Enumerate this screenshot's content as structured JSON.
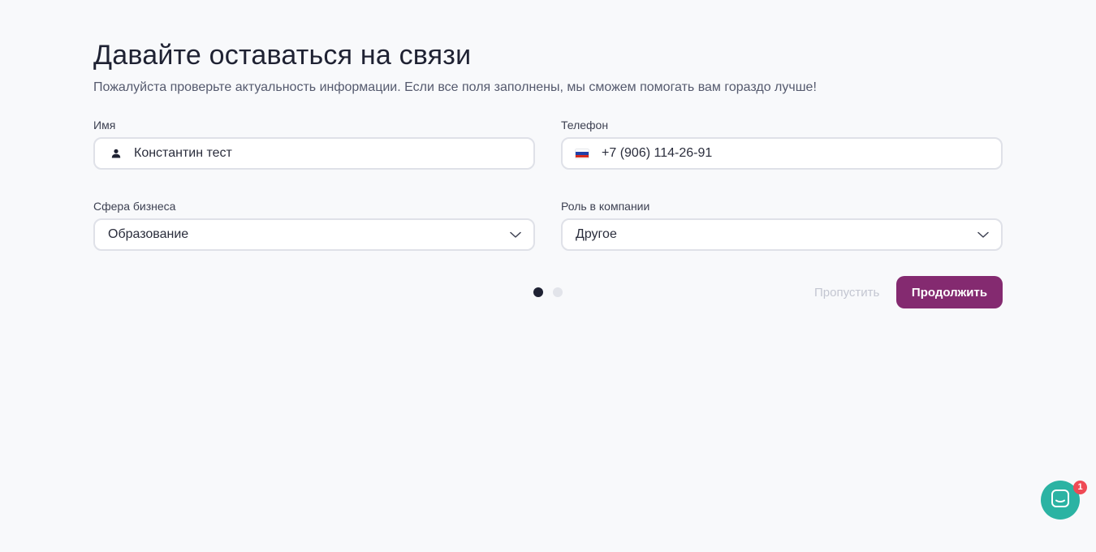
{
  "header": {
    "title": "Давайте оставаться на связи",
    "subtitle": "Пожалуйста проверьте актуальность информации. Если все поля заполнены, мы сможем помогать вам гораздо лучше!"
  },
  "form": {
    "name": {
      "label": "Имя",
      "value": "Константин тест",
      "icon": "person-icon"
    },
    "phone": {
      "label": "Телефон",
      "value": "+7 (906) 114-26-91",
      "icon": "russia-flag-icon"
    },
    "business_sphere": {
      "label": "Сфера бизнеса",
      "selected": "Образование",
      "icon": "chevron-down-icon"
    },
    "company_role": {
      "label": "Роль в компании",
      "selected": "Другое",
      "icon": "chevron-down-icon"
    }
  },
  "pager": {
    "current_step": 1,
    "total_steps": 2
  },
  "actions": {
    "skip_label": "Пропустить",
    "continue_label": "Продолжить"
  },
  "chat": {
    "icon": "chat-icon",
    "badge_count": "1"
  },
  "colors": {
    "background": "#f8f9fb",
    "accent": "#842a70",
    "chat": "#2bb3a3",
    "badge": "#ef4a55"
  }
}
